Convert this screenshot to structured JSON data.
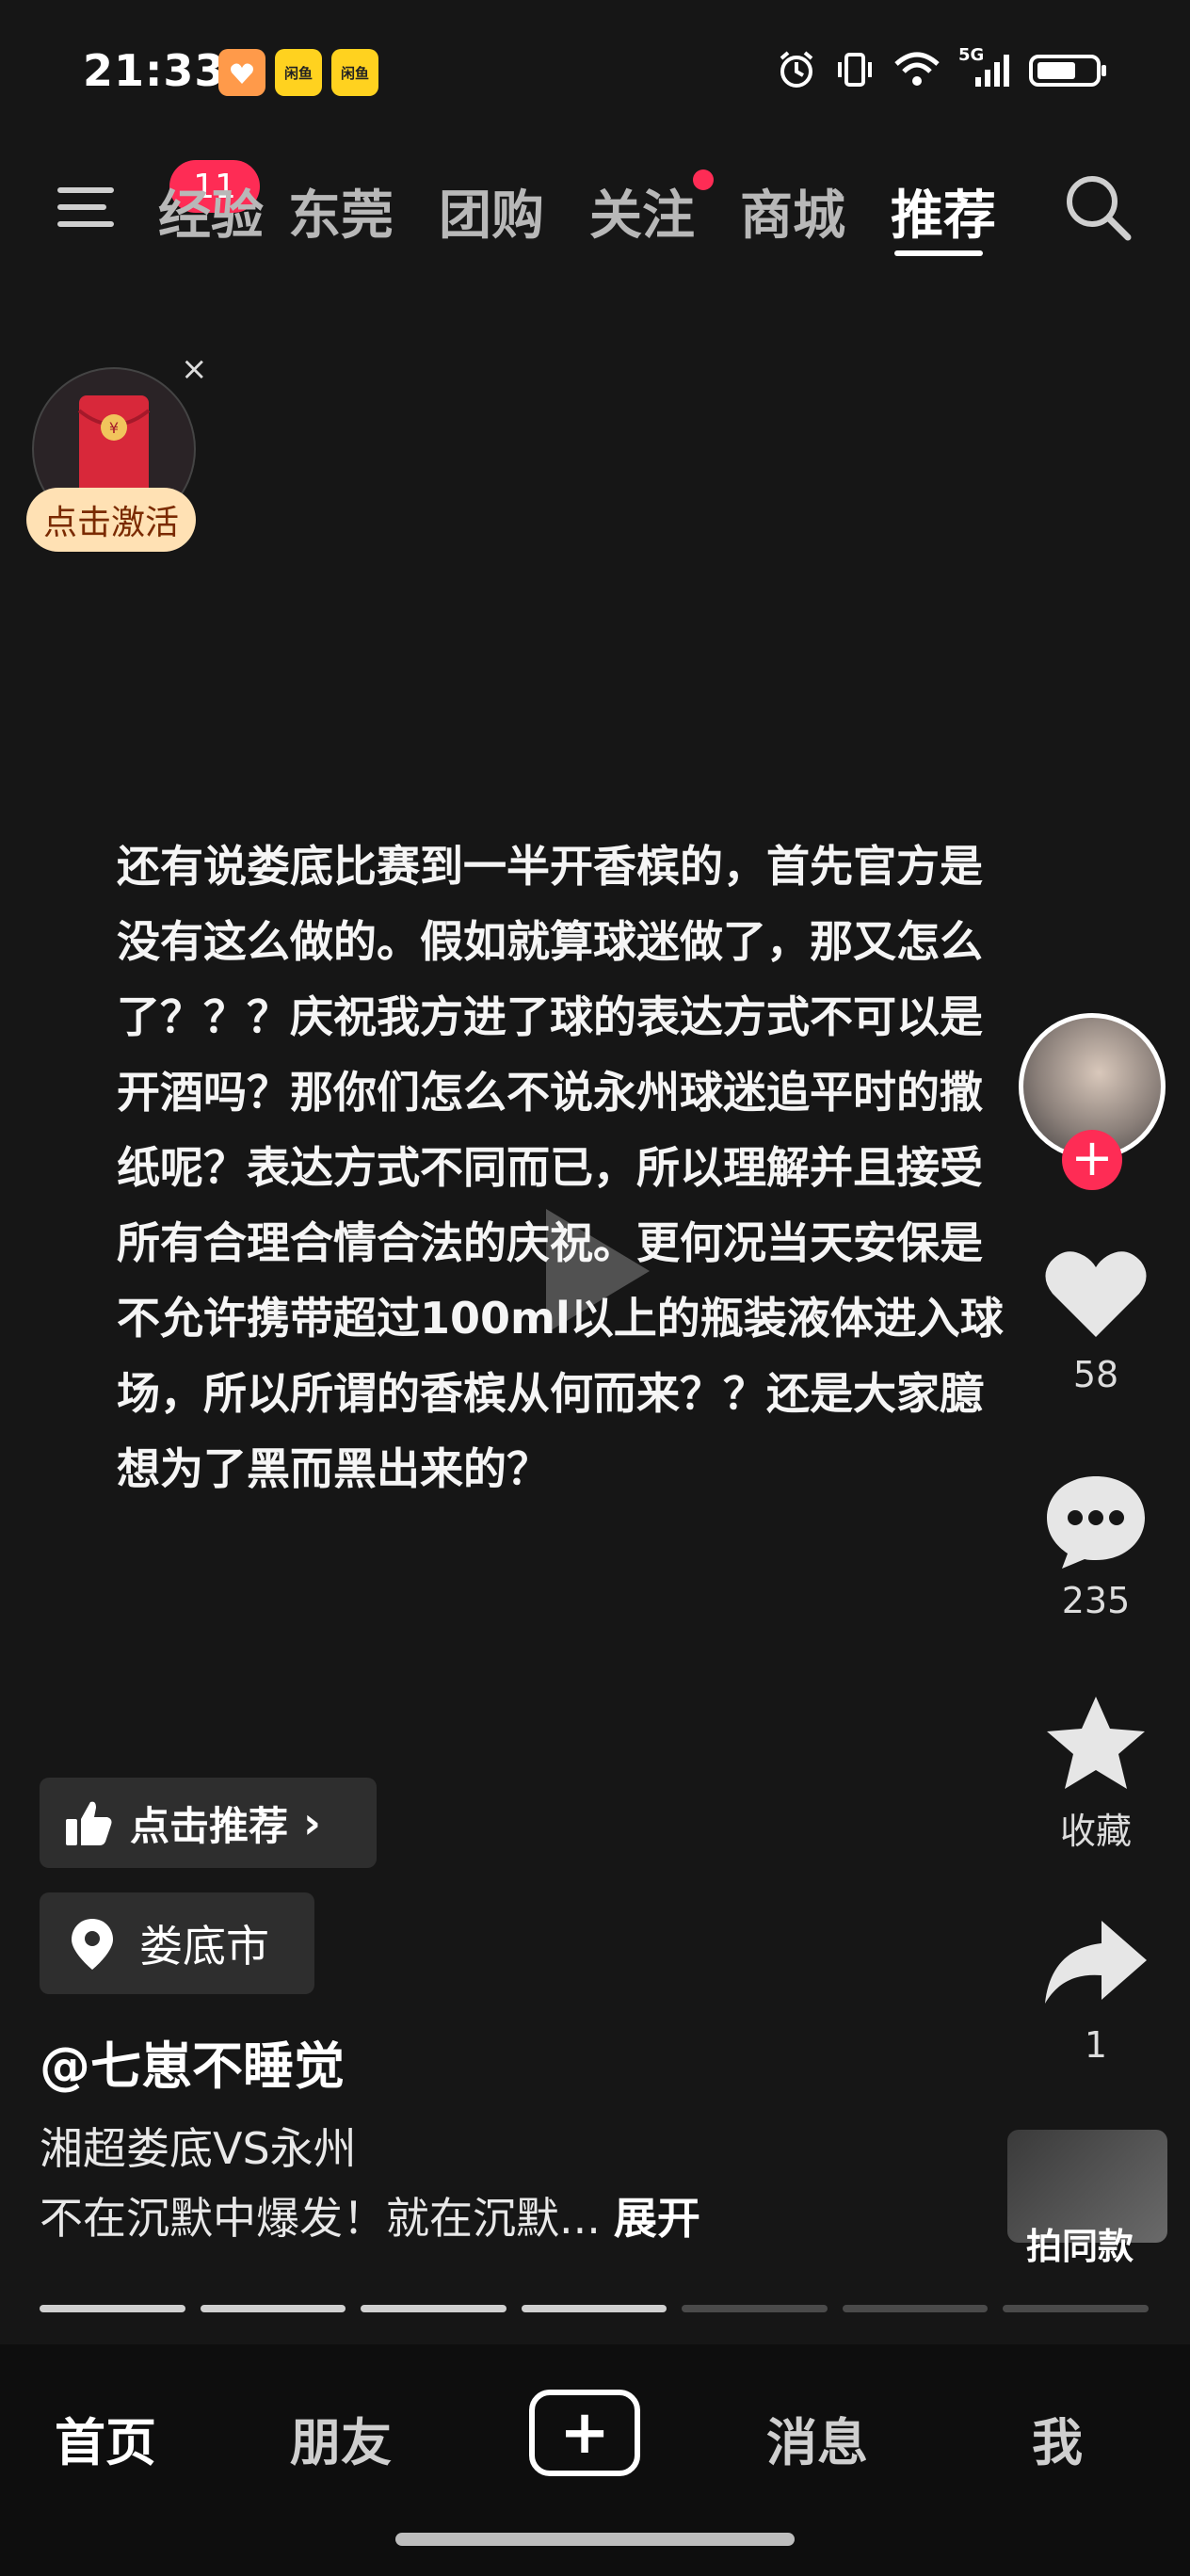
{
  "status_bar": {
    "time": "21:33",
    "app_badges": [
      "闲鱼",
      "闲鱼"
    ],
    "network": "5G"
  },
  "top_nav": {
    "menu_badge": "11",
    "tabs": [
      {
        "label": "经验"
      },
      {
        "label": "东莞"
      },
      {
        "label": "团购"
      },
      {
        "label": "关注"
      },
      {
        "label": "商城"
      },
      {
        "label": "推荐"
      }
    ],
    "active_tab": "推荐"
  },
  "red_packet": {
    "label": "点击激活"
  },
  "post": {
    "lines": [
      "还有说娄底比赛到一半开香槟的，首先官方是",
      "没有这么做的。假如就算球迷做了，那又怎么",
      "了？？？庆祝我方进了球的表达方式不可以是",
      "开酒吗？那你们怎么不说永州球迷追平时的撒",
      "纸呢？表达方式不同而已，所以理解并且接受",
      "所有合理合情合法的庆祝。更何况当天安保是",
      "不允许携带超过100ml以上的瓶装液体进入球",
      "场，所以所谓的香槟从何而来？？还是大家臆",
      "想为了黑而黑出来的？"
    ]
  },
  "actions": {
    "likes": "58",
    "comments": "235",
    "favorite_label": "收藏",
    "shares": "1",
    "same_style_label": "拍同款"
  },
  "info": {
    "recommend_label": "点击推荐",
    "location": "娄底市",
    "username": "@七崽不睡觉",
    "title": "湘超娄底VS永州",
    "description": "不在沉默中爆发！就在沉默...",
    "expand_label": "展开"
  },
  "progress": {
    "segments_total": 7,
    "segments_done": 4
  },
  "tab_bar": {
    "items": [
      "首页",
      "朋友",
      "消息",
      "我"
    ],
    "active": "首页"
  },
  "colors": {
    "accent": "#fe2c55",
    "background": "#161616"
  }
}
